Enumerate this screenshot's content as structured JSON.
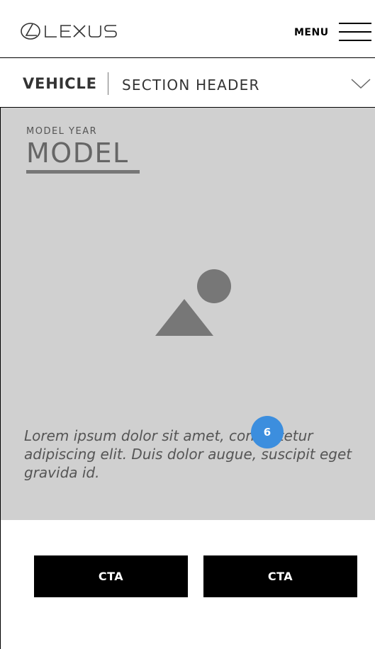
{
  "header": {
    "logo_text": "LEXUS",
    "menu_label": "MENU"
  },
  "section_header": {
    "vehicle_label": "VEHICLE",
    "title": "SECTION HEADER"
  },
  "hero": {
    "model_year": "MODEL YEAR",
    "model": "MODEL",
    "image_icon": "image-placeholder-icon",
    "body_text": "Lorem ipsum dolor sit amet, consectetur adipiscing elit. Duis dolor augue, suscipit eget gravida id.",
    "badge": "6",
    "background_color": "#d0d0d0",
    "badge_color": "#3c8ede"
  },
  "ctas": [
    {
      "label": "CTA"
    },
    {
      "label": "CTA"
    }
  ]
}
